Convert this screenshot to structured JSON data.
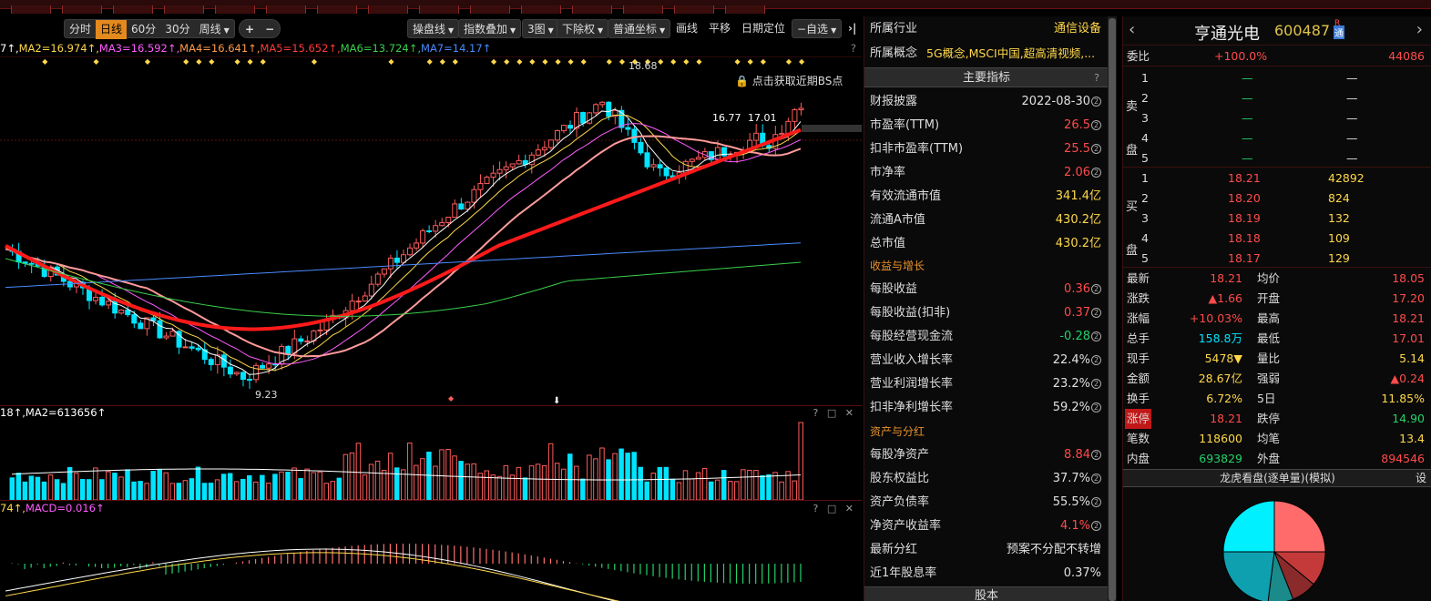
{
  "toolbar": {
    "period_tabs": [
      "分时",
      "日线",
      "60分",
      "30分",
      "周线"
    ],
    "active_tab": "日线",
    "right_buttons": [
      "操盘线",
      "指数叠加",
      "3图",
      "下除权",
      "普通坐标",
      "画线",
      "平移",
      "日期定位",
      "−自选"
    ],
    "plus": "+",
    "minus": "−",
    "expand": "›|"
  },
  "ma_legend": [
    {
      "text": "7↑,",
      "color": "#ffffff"
    },
    {
      "text": "MA2=16.974↑,",
      "color": "#ffd84a"
    },
    {
      "text": "MA3=16.592↑,",
      "color": "#ff5bff"
    },
    {
      "text": "MA4=16.641↑,",
      "color": "#ff9a4a"
    },
    {
      "text": "MA5=15.652↑,",
      "color": "#ff3a3a"
    },
    {
      "text": "MA6=13.724↑,",
      "color": "#3ad04a"
    },
    {
      "text": "MA7=14.17↑",
      "color": "#4a8aff"
    }
  ],
  "main_chart": {
    "high_label": "18.68",
    "low_label": "9.23",
    "mid_label": "16.77",
    "mid_label2": "17.01",
    "bs_hint": "点击获取近期BS点",
    "help": "?"
  },
  "volume_pane": {
    "legend": "18↑,MA2=613656↑",
    "icons": "? □ ✕"
  },
  "macd_pane": {
    "legend_a": "74↑,",
    "legend_b": "MACD=0.016↑",
    "icons": "? □ ✕"
  },
  "info_panel": {
    "industry_label": "所属行业",
    "industry_value": "通信设备",
    "concept_label": "所属概念",
    "concept_value": "5G概念,MSCI中国,超高清视频,...",
    "main_header": "主要指标",
    "help": "?",
    "rows_a": [
      {
        "label": "财报披露",
        "value": "2022-08-30",
        "color": "#e0e0e0"
      },
      {
        "label": "市盈率(TTM)",
        "value": "26.5",
        "color": "#ff4b4b"
      },
      {
        "label": "扣非市盈率(TTM)",
        "value": "25.5",
        "color": "#ff4b4b"
      },
      {
        "label": "市净率",
        "value": "2.06",
        "color": "#ff4b4b"
      },
      {
        "label": "有效流通市值",
        "value": "341.4亿",
        "color": "#ffd84a"
      },
      {
        "label": "流通A市值",
        "value": "430.2亿",
        "color": "#ffd84a"
      },
      {
        "label": "总市值",
        "value": "430.2亿",
        "color": "#ffd84a"
      }
    ],
    "sec_growth": "收益与增长",
    "rows_b": [
      {
        "label": "每股收益",
        "value": "0.36",
        "color": "#ff4b4b"
      },
      {
        "label": "每股收益(扣非)",
        "value": "0.37",
        "color": "#ff4b4b"
      },
      {
        "label": "每股经营现金流",
        "value": "-0.28",
        "color": "#22d26a"
      },
      {
        "label": "营业收入增长率",
        "value": "22.4%",
        "color": "#e0e0e0"
      },
      {
        "label": "营业利润增长率",
        "value": "23.2%",
        "color": "#e0e0e0"
      },
      {
        "label": "扣非净利增长率",
        "value": "59.2%",
        "color": "#e0e0e0"
      }
    ],
    "sec_asset": "资产与分红",
    "rows_c": [
      {
        "label": "每股净资产",
        "value": "8.84",
        "color": "#ff4b4b"
      },
      {
        "label": "股东权益比",
        "value": "37.7%",
        "color": "#e0e0e0"
      },
      {
        "label": "资产负债率",
        "value": "55.5%",
        "color": "#e0e0e0"
      },
      {
        "label": "净资产收益率",
        "value": "4.1%",
        "color": "#ff4b4b"
      },
      {
        "label": "最新分红",
        "value": "预案不分配不转增",
        "color": "#e0e0e0"
      },
      {
        "label": "近1年股息率",
        "value": "0.37%",
        "color": "#e0e0e0"
      }
    ],
    "bottom_header": "股本"
  },
  "quote": {
    "name": "亨通光电",
    "code": "600487",
    "badge_r": "R",
    "badge_t": "通",
    "webi_label": "委比",
    "webi_value": "+100.0%",
    "webi_diff": "44086",
    "sell_side_label": "卖盘",
    "buy_side_label": "买盘",
    "asks": [
      {
        "n": "5",
        "p": "—",
        "v": "—"
      },
      {
        "n": "4",
        "p": "—",
        "v": "—"
      },
      {
        "n": "3",
        "p": "—",
        "v": "—"
      },
      {
        "n": "2",
        "p": "—",
        "v": "—"
      },
      {
        "n": "1",
        "p": "—",
        "v": "—"
      }
    ],
    "bids": [
      {
        "n": "1",
        "p": "18.21",
        "v": "42892"
      },
      {
        "n": "2",
        "p": "18.20",
        "v": "824"
      },
      {
        "n": "3",
        "p": "18.19",
        "v": "132"
      },
      {
        "n": "4",
        "p": "18.18",
        "v": "109"
      },
      {
        "n": "5",
        "p": "18.17",
        "v": "129"
      }
    ],
    "stats": [
      [
        {
          "l": "最新",
          "v": "18.21",
          "c": "#ff4b4b"
        },
        {
          "l": "均价",
          "v": "18.05",
          "c": "#ff4b4b"
        }
      ],
      [
        {
          "l": "涨跌",
          "v": "▲1.66",
          "c": "#ff4b4b"
        },
        {
          "l": "开盘",
          "v": "17.20",
          "c": "#ff4b4b"
        }
      ],
      [
        {
          "l": "涨幅",
          "v": "+10.03%",
          "c": "#ff4b4b"
        },
        {
          "l": "最高",
          "v": "18.21",
          "c": "#ff4b4b"
        }
      ],
      [
        {
          "l": "总手",
          "v": "158.8万",
          "c": "#00e4ff"
        },
        {
          "l": "最低",
          "v": "17.01",
          "c": "#ff4b4b"
        }
      ],
      [
        {
          "l": "现手",
          "v": "5478▼",
          "c": "#ffd84a"
        },
        {
          "l": "量比",
          "v": "5.14",
          "c": "#ffd84a"
        }
      ],
      [
        {
          "l": "金额",
          "v": "28.67亿",
          "c": "#ffd84a"
        },
        {
          "l": "强弱",
          "v": "▲0.24",
          "c": "#ff4b4b"
        }
      ],
      [
        {
          "l": "换手",
          "v": "6.72%",
          "c": "#ffd84a"
        },
        {
          "l": "5日",
          "v": "11.85%",
          "c": "#ffd84a"
        }
      ],
      [
        {
          "l": "涨停",
          "v": "18.21",
          "c": "#ff4b4b"
        },
        {
          "l": "跌停",
          "v": "14.90",
          "c": "#22d26a"
        }
      ],
      [
        {
          "l": "笔数",
          "v": "118600",
          "c": "#ffd84a"
        },
        {
          "l": "均笔",
          "v": "13.4",
          "c": "#ffd84a"
        }
      ],
      [
        {
          "l": "内盘",
          "v": "693829",
          "c": "#22d26a"
        },
        {
          "l": "外盘",
          "v": "894546",
          "c": "#ff4b4b"
        }
      ]
    ],
    "longhu_header": "龙虎看盘(逐单量)(模拟)",
    "settings": "设"
  }
}
